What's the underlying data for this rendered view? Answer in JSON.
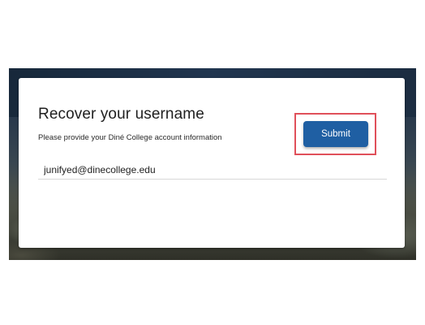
{
  "card": {
    "title": "Recover your username",
    "subtitle": "Please provide your Diné College account information"
  },
  "form": {
    "email_value": "junifyed@dinecollege.edu",
    "submit_label": "Submit"
  },
  "colors": {
    "button_bg": "#1f5fa3",
    "highlight_border": "#e0505a",
    "card_bg": "#ffffff"
  }
}
